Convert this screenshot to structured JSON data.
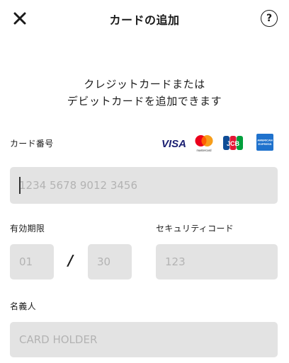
{
  "header": {
    "title": "カードの追加",
    "close_icon": "close-icon",
    "help_icon": "question-mark-icon",
    "help_symbol": "?"
  },
  "intro": {
    "line1": "クレジットカードまたは",
    "line2": "デビットカードを追加できます"
  },
  "card_number": {
    "label": "カード番号",
    "placeholder": "1234 5678 9012 3456"
  },
  "brands": {
    "visa": "VISA",
    "mastercard_caption": "mastercard",
    "jcb": "JCB",
    "amex_line1": "AMERICAN",
    "amex_line2": "EXPRESS"
  },
  "expiry": {
    "label": "有効期限",
    "month_placeholder": "01",
    "separator": "/",
    "year_placeholder": "30"
  },
  "security_code": {
    "label": "セキュリティコード",
    "placeholder": "123"
  },
  "holder": {
    "label": "名義人",
    "placeholder": "CARD HOLDER"
  },
  "colors": {
    "field_bg": "#e3e3e3",
    "placeholder": "#b3b3b3",
    "visa": "#1a1f71",
    "mc_red": "#eb001b",
    "mc_orange": "#f79e1b",
    "amex": "#1f72cd"
  }
}
